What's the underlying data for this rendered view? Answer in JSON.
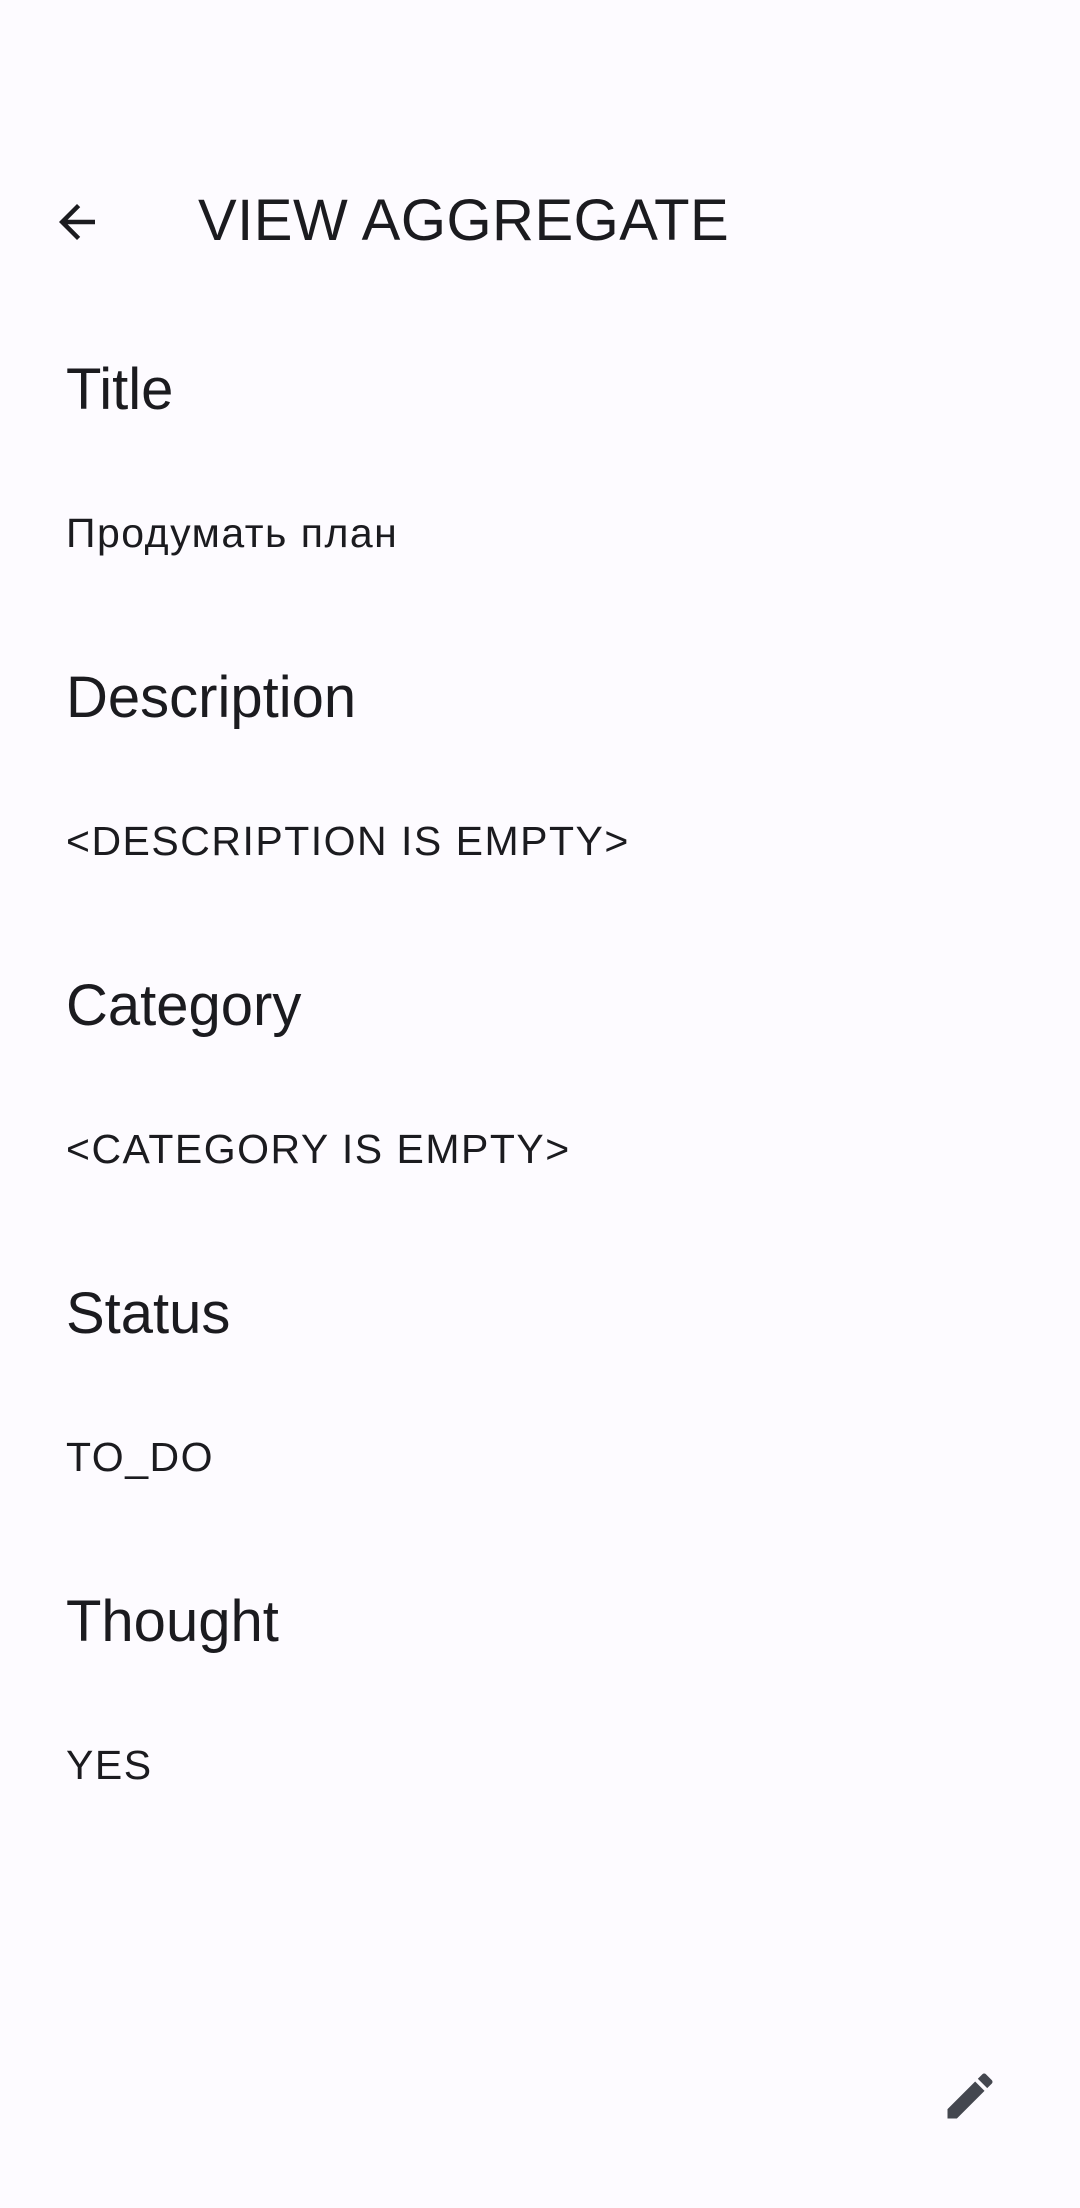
{
  "app_bar": {
    "title": "VIEW AGGREGATE",
    "back_icon": "arrow-back-icon"
  },
  "fields": [
    {
      "label": "Title",
      "value": "Продумать план"
    },
    {
      "label": "Description",
      "value": "<DESCRIPTION IS EMPTY>"
    },
    {
      "label": "Category",
      "value": "<CATEGORY IS EMPTY>"
    },
    {
      "label": "Status",
      "value": "TO_DO"
    },
    {
      "label": "Thought",
      "value": "YES"
    }
  ],
  "fab": {
    "icon": "edit-pencil-icon"
  },
  "colors": {
    "background": "#fdfbff",
    "text": "#1b1b1f",
    "icon": "#44474f"
  }
}
